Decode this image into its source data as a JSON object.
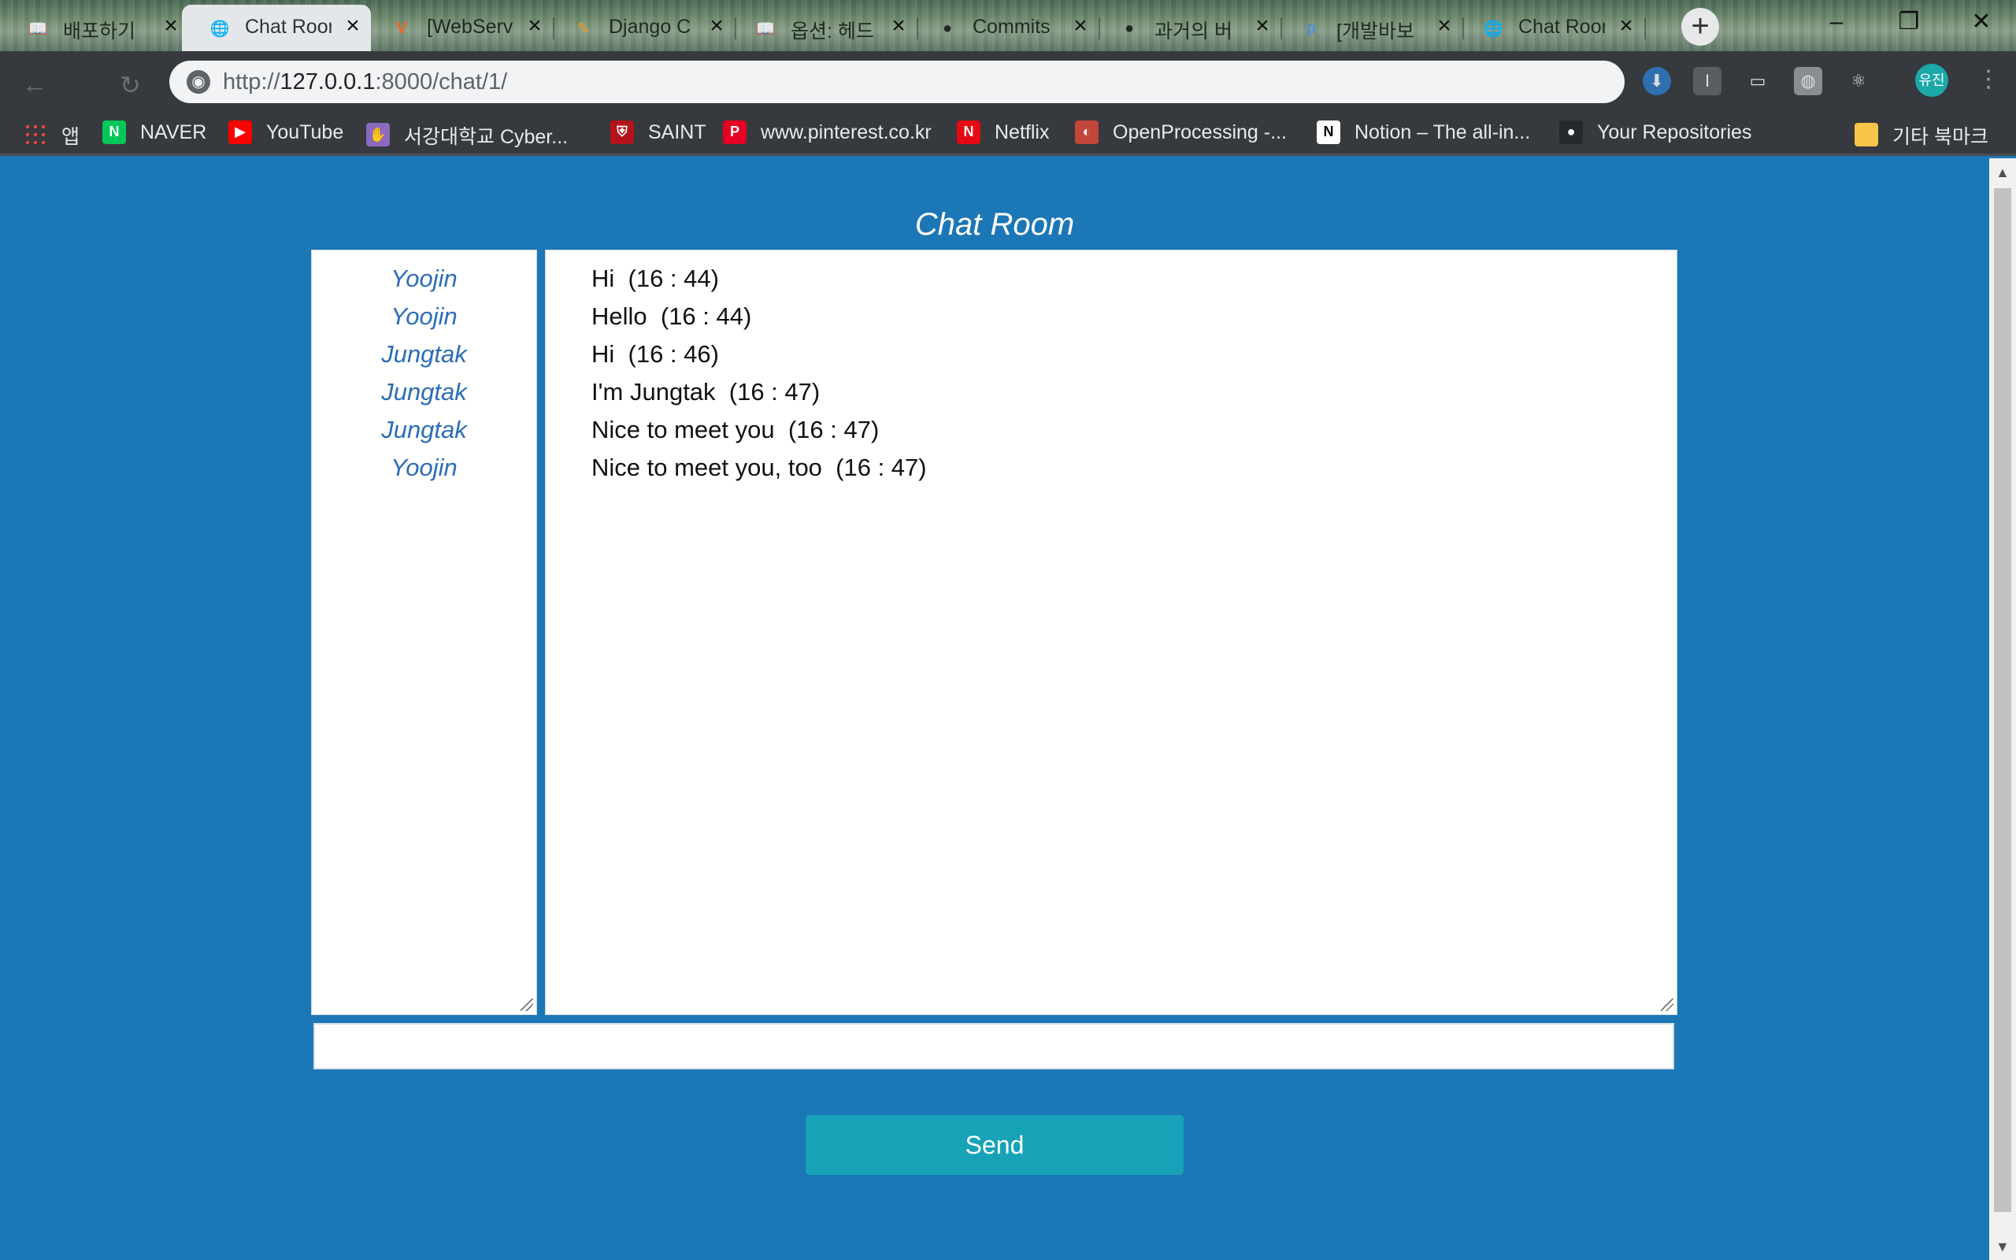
{
  "browser": {
    "tabs": [
      {
        "title": "배포하기",
        "icon": "book-icon",
        "icon_char": "📖"
      },
      {
        "title": "Chat Room",
        "icon": "globe-icon",
        "icon_char": "🌐",
        "active": true
      },
      {
        "title": "[WebServ",
        "icon": "v-logo-icon",
        "icon_char": "V",
        "icon_color": "#f16522"
      },
      {
        "title": "Django C",
        "icon": "pencil-icon",
        "icon_char": "✎",
        "icon_color": "#e5a21c"
      },
      {
        "title": "옵션: 헤드",
        "icon": "book-icon",
        "icon_char": "📖"
      },
      {
        "title": "Commits",
        "icon": "github-icon",
        "icon_char": "●"
      },
      {
        "title": "과거의 버",
        "icon": "black-circle-icon",
        "icon_char": "●"
      },
      {
        "title": "[개발바보",
        "icon": "p-logo-icon",
        "icon_char": "p",
        "icon_color": "#4a90d9"
      },
      {
        "title": "Chat Room",
        "icon": "globe-icon",
        "icon_char": "🌐"
      }
    ],
    "new_tab": "+",
    "window_controls": {
      "minimize": "–",
      "restore": "❐",
      "close": "✕"
    },
    "address": {
      "host": "127.0.0.1",
      "prefix": "http://",
      "suffix": ":8000/chat/1/"
    },
    "profile": "유진",
    "bookmarks": [
      {
        "label": "앱",
        "icon": "apps-grid-icon",
        "color": "#e8453c"
      },
      {
        "label": "NAVER",
        "icon": "naver-icon",
        "color": "#03c75a",
        "char": "N"
      },
      {
        "label": "YouTube",
        "icon": "youtube-icon",
        "color": "#ff0000",
        "char": "▶"
      },
      {
        "label": "서강대학교 Cyber...",
        "icon": "hand-logo-icon",
        "color": "#8a6bbf",
        "char": "✋"
      },
      {
        "label": "SAINT",
        "icon": "shield-logo-icon",
        "color": "#b5121b",
        "char": "⛨"
      },
      {
        "label": "www.pinterest.co.kr",
        "icon": "pinterest-icon",
        "color": "#e60023",
        "char": "P"
      },
      {
        "label": "Netflix",
        "icon": "netflix-icon",
        "color": "#e50914",
        "char": "N"
      },
      {
        "label": "OpenProcessing -...",
        "icon": "openprocessing-icon",
        "color": "#c2463a",
        "char": "◐"
      },
      {
        "label": "Notion – The all-in...",
        "icon": "notion-icon",
        "color": "#ffffff",
        "char": "N"
      },
      {
        "label": "Your Repositories",
        "icon": "github-icon",
        "color": "#24292e",
        "char": "●"
      },
      {
        "label": "기타 북마크",
        "icon": "folder-icon",
        "color": "#f6c54a",
        "char": ""
      }
    ]
  },
  "page": {
    "title": "Chat Room",
    "users": [
      "Yoojin",
      "Yoojin",
      "Jungtak",
      "Jungtak",
      "Jungtak",
      "Yoojin"
    ],
    "messages": [
      "Hi  (16 : 44)",
      "Hello  (16 : 44)",
      "Hi  (16 : 46)",
      "I'm Jungtak  (16 : 47)",
      "Nice to meet you  (16 : 47)",
      "Nice to meet you, too  (16 : 47)"
    ],
    "input_value": "",
    "send_label": "Send"
  }
}
